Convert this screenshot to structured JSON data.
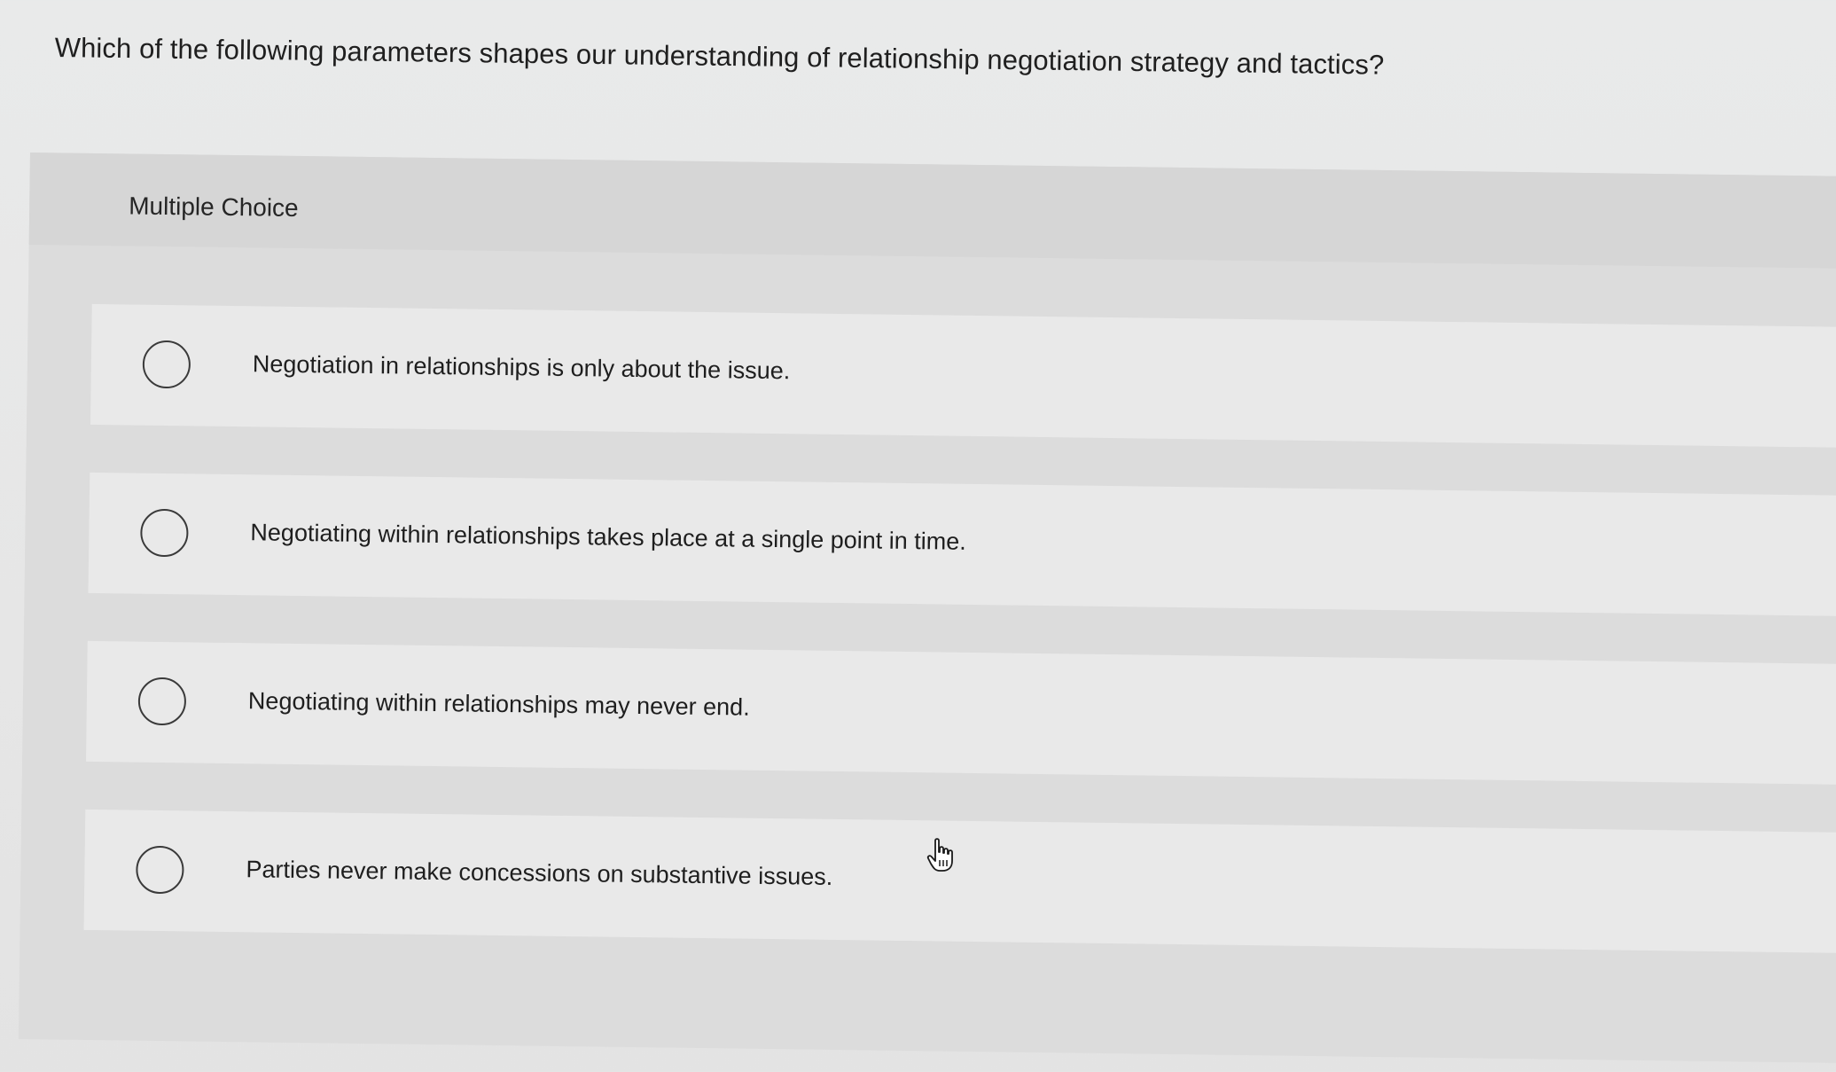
{
  "question": {
    "text": "Which of the following parameters shapes our understanding of relationship negotiation strategy and tactics?"
  },
  "panel": {
    "title": "Multiple Choice"
  },
  "options": [
    {
      "label": "Negotiation in relationships is only about the issue.",
      "selected": false
    },
    {
      "label": "Negotiating within relationships takes place at a single point in time.",
      "selected": false
    },
    {
      "label": "Negotiating within relationships may never end.",
      "selected": false
    },
    {
      "label": "Parties never make concessions on substantive issues.",
      "selected": false
    }
  ],
  "cursor": {
    "icon": "hand-pointer-icon"
  },
  "colors": {
    "page_background": "#e7e7e7",
    "panel_background": "#dcdcdc",
    "option_background": "#e9e9e9",
    "radio_border": "#3a3a3a",
    "text": "#1f1f1f"
  }
}
